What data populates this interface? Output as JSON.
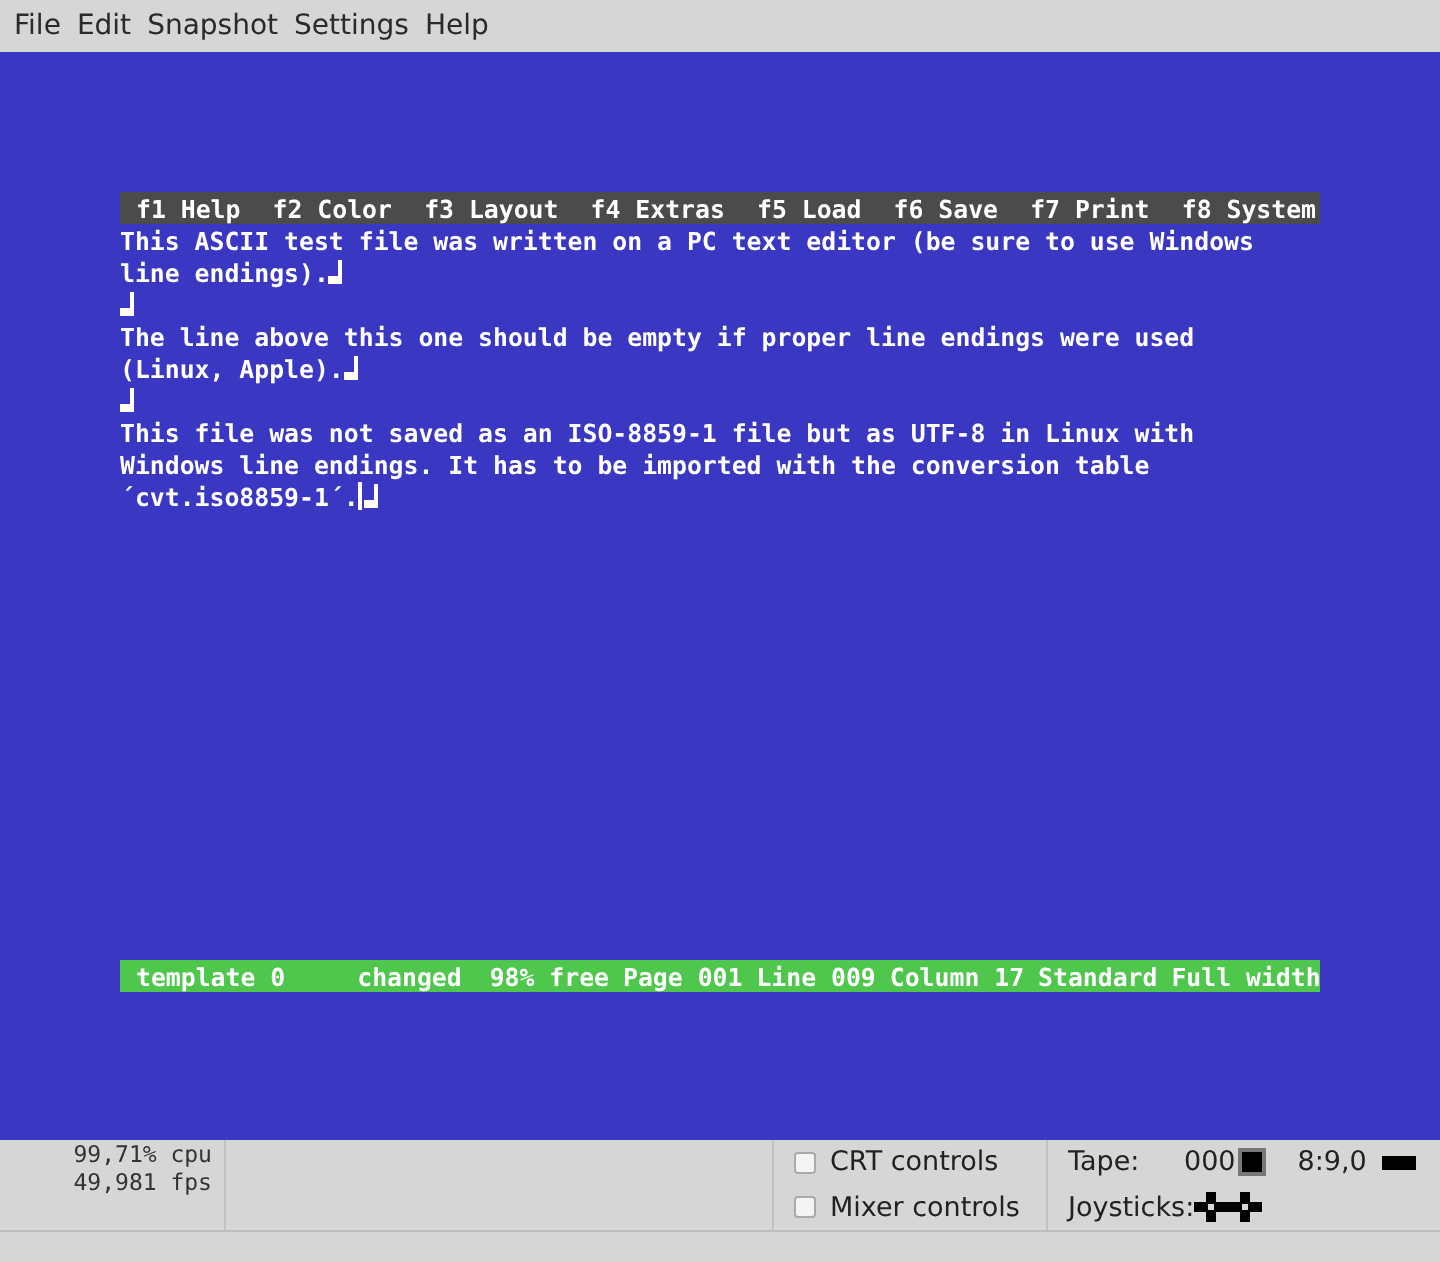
{
  "menu": [
    "File",
    "Edit",
    "Snapshot",
    "Settings",
    "Help"
  ],
  "screen": {
    "function_keys": [
      "f1 Help",
      "f2 Color",
      "f3 Layout",
      "f4 Extras",
      "f5 Load",
      "f6 Save",
      "f7 Print",
      "f8 System"
    ],
    "lines": [
      {
        "text": "This ASCII test file was written on a PC text editor (be sure to use Windows",
        "eol": false,
        "cursor": false
      },
      {
        "text": "line endings).",
        "eol": true,
        "cursor": false
      },
      {
        "eol": true,
        "cursor": false
      },
      {
        "text": "The line above this one should be empty if proper line endings were used",
        "eol": false,
        "cursor": false
      },
      {
        "text": "(Linux, Apple).",
        "eol": true,
        "cursor": false
      },
      {
        "eol": true,
        "cursor": false
      },
      {
        "text": "This file was not saved as an ISO-8859-1 file but as UTF-8 in Linux with",
        "eol": false,
        "cursor": false
      },
      {
        "text": "Windows line endings. It has to be imported with the conversion table",
        "eol": false,
        "cursor": false
      },
      {
        "text": "´cvt.iso8859-1´.",
        "eol": true,
        "cursor": true
      }
    ],
    "status": [
      "template 0",
      "changed",
      "98% free",
      "Page 001",
      "Line 009",
      "Column 17",
      "Standard",
      "Full width"
    ]
  },
  "stats": {
    "cpu": "99,71% cpu",
    "fps": "49,981 fps"
  },
  "toggles": [
    {
      "label": "CRT controls",
      "checked": false
    },
    {
      "label": "Mixer controls",
      "checked": false
    }
  ],
  "tape": {
    "label": "Tape:",
    "counter": "000"
  },
  "drive": {
    "track": "8:9,0"
  },
  "joysticks": {
    "label": "Joysticks:"
  }
}
